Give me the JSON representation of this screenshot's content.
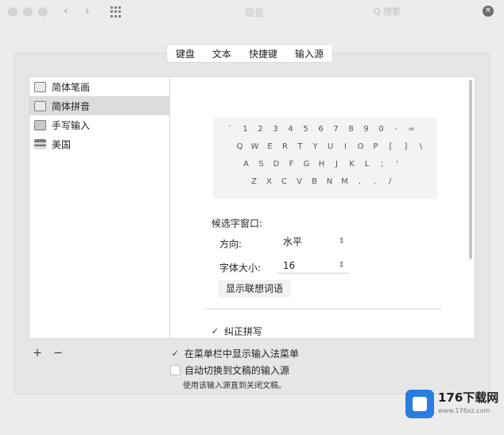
{
  "window": {
    "title": "键盘",
    "search": "Q 搜索"
  },
  "tabs": [
    {
      "label": "键盘"
    },
    {
      "label": "文本"
    },
    {
      "label": "快捷键"
    },
    {
      "label": "输入源",
      "active": true
    }
  ],
  "sources": [
    {
      "label": "简体笔画",
      "icon": "stroke-input-icon"
    },
    {
      "label": "简体拼音",
      "icon": "pinyin-input-icon",
      "selected": true
    },
    {
      "label": "手写输入",
      "icon": "handwriting-input-icon"
    },
    {
      "label": "美国",
      "icon": "us-flag-icon"
    }
  ],
  "list_controls": {
    "add": "+",
    "remove": "−"
  },
  "keyboard": {
    "rows": [
      [
        "`",
        "1",
        "2",
        "3",
        "4",
        "5",
        "6",
        "7",
        "8",
        "9",
        "0",
        "-",
        "="
      ],
      [
        "Q",
        "W",
        "E",
        "R",
        "T",
        "Y",
        "U",
        "I",
        "O",
        "P",
        "[",
        "]",
        "\\"
      ],
      [
        "A",
        "S",
        "D",
        "F",
        "G",
        "H",
        "J",
        "K",
        "L",
        ";",
        "'"
      ],
      [
        "Z",
        "X",
        "C",
        "V",
        "B",
        "N",
        "M",
        ",",
        ".",
        "/"
      ]
    ]
  },
  "candidate": {
    "label": "候选字窗口:",
    "direction_label": "方向:",
    "direction_value": "水平",
    "font_size_label": "字体大小:",
    "font_size_value": "16"
  },
  "show_predictions_button": "显示联想词语",
  "autocorrect": {
    "label": "纠正拼写",
    "checked": true
  },
  "menu_bar_option": {
    "label": "在菜单栏中显示输入法菜单",
    "checked": true
  },
  "auto_switch_option": {
    "label": "自动切换到文稿的输入源",
    "checked": false
  },
  "auto_switch_note": "使用该输入源直到关闭文稿。",
  "watermark": {
    "name": "176下载网",
    "url": "www.176xz.com"
  },
  "colors": {
    "selection": "#dcdcdc",
    "panel": "#e6e6e6",
    "accent": "#2a7de1"
  }
}
